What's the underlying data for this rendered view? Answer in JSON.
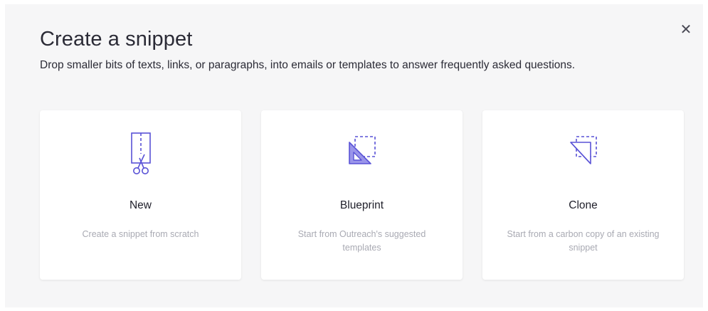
{
  "dialog": {
    "title": "Create a snippet",
    "subtitle": "Drop smaller bits of texts, links, or paragraphs, into emails or templates to answer frequently asked questions.",
    "close_symbol": "✕"
  },
  "options": [
    {
      "title": "New",
      "description": "Create a snippet from scratch",
      "icon": "scissors-page-icon"
    },
    {
      "title": "Blueprint",
      "description": "Start from Outreach's suggested templates",
      "icon": "blueprint-triangle-icon"
    },
    {
      "title": "Clone",
      "description": "Start from a carbon copy of an existing snippet",
      "icon": "clone-triangle-icon"
    }
  ],
  "colors": {
    "accent": "#5952d6",
    "accent_fill": "#9a95ea",
    "background": "#f6f6f7"
  }
}
